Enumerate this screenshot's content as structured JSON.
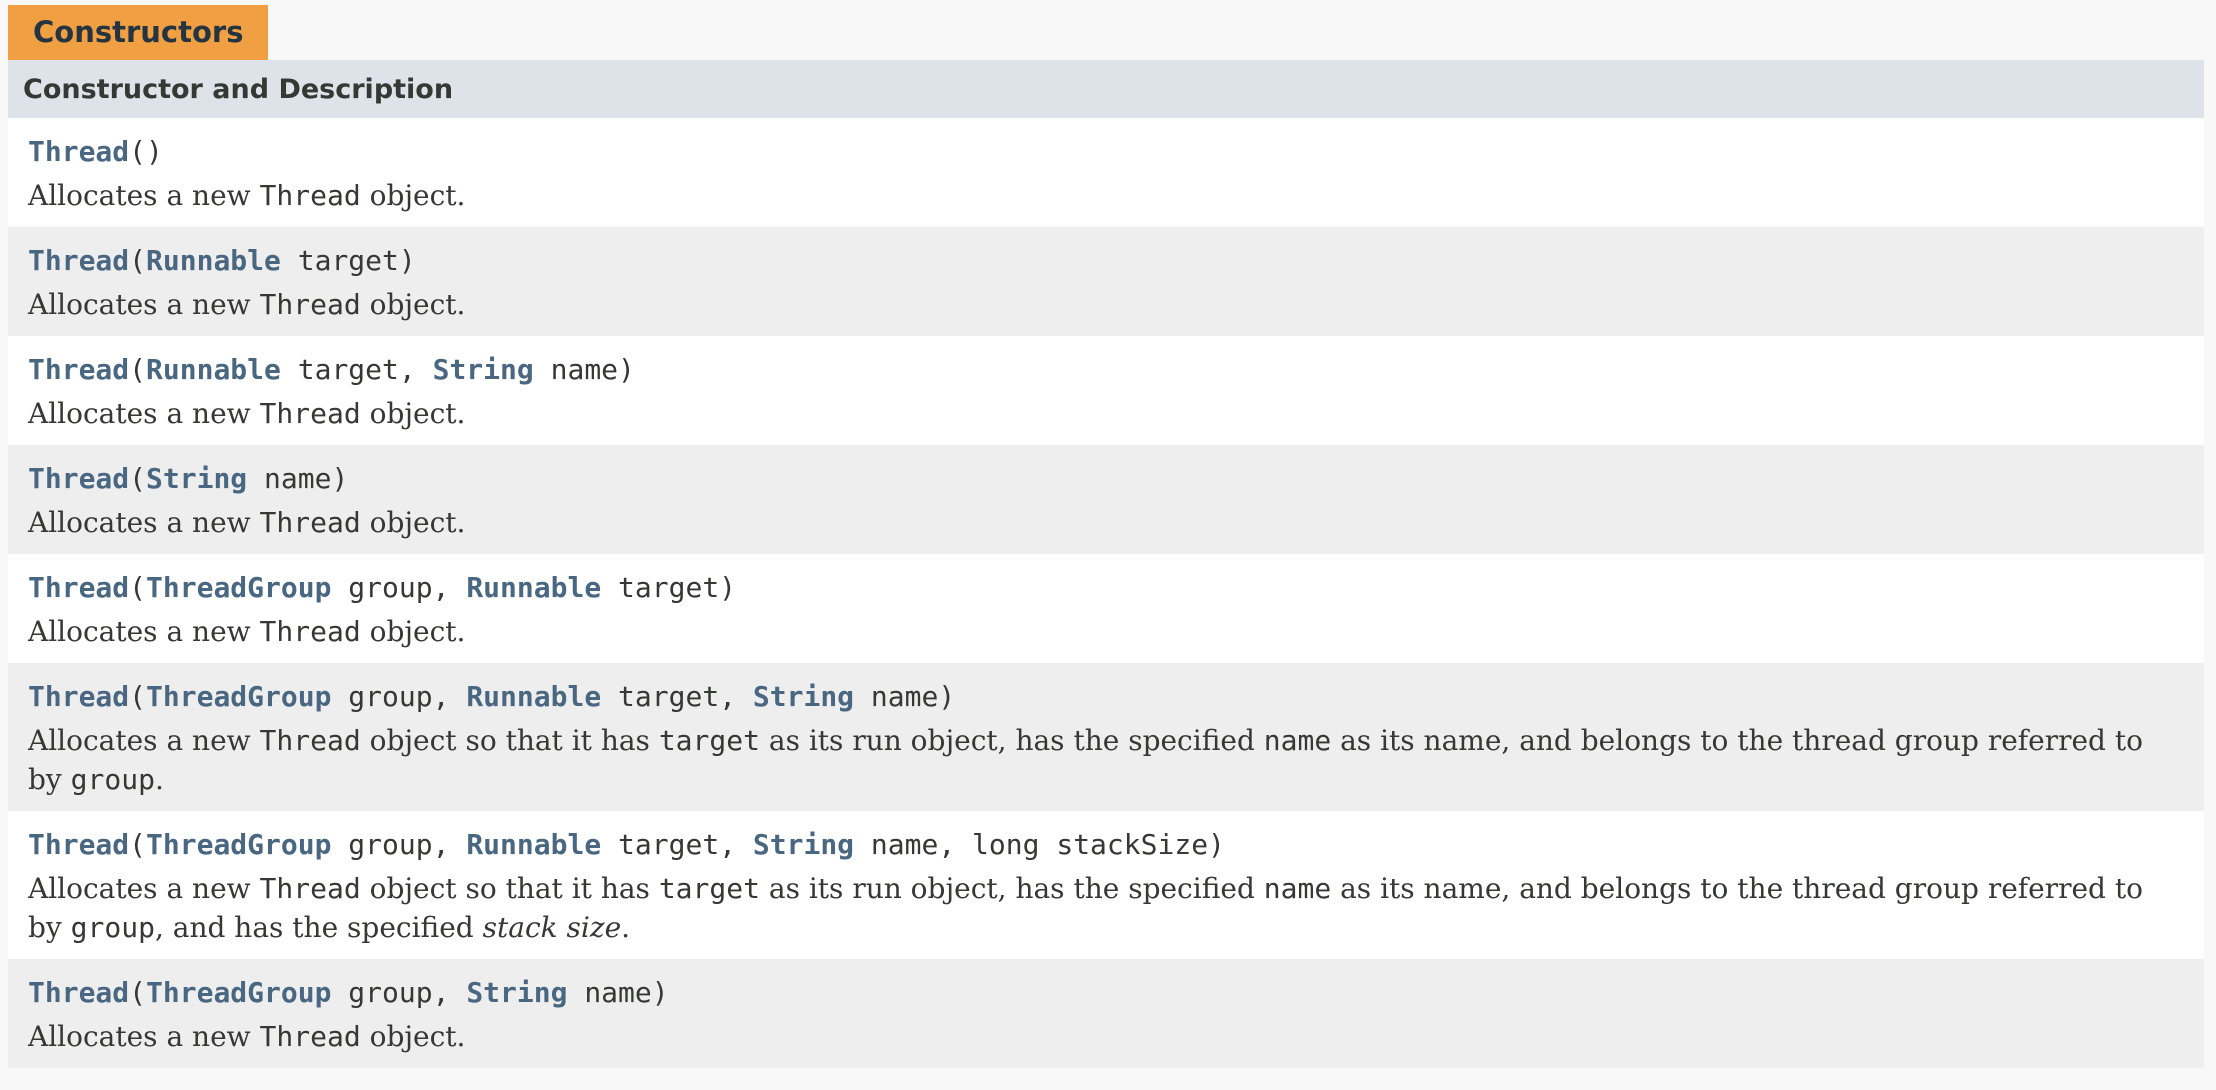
{
  "caption": "Constructors",
  "table_header": "Constructor and Description",
  "constructors": [
    {
      "sig": [
        {
          "t": "Thread",
          "link": true
        },
        {
          "t": "()"
        }
      ],
      "desc": [
        {
          "t": "Allocates a new "
        },
        {
          "t": "Thread",
          "code": true
        },
        {
          "t": " object."
        }
      ]
    },
    {
      "sig": [
        {
          "t": "Thread",
          "link": true
        },
        {
          "t": "("
        },
        {
          "t": "Runnable",
          "link": true
        },
        {
          "t": " target)"
        }
      ],
      "desc": [
        {
          "t": "Allocates a new "
        },
        {
          "t": "Thread",
          "code": true
        },
        {
          "t": " object."
        }
      ]
    },
    {
      "sig": [
        {
          "t": "Thread",
          "link": true
        },
        {
          "t": "("
        },
        {
          "t": "Runnable",
          "link": true
        },
        {
          "t": " target, "
        },
        {
          "t": "String",
          "link": true
        },
        {
          "t": " name)"
        }
      ],
      "desc": [
        {
          "t": "Allocates a new "
        },
        {
          "t": "Thread",
          "code": true
        },
        {
          "t": " object."
        }
      ]
    },
    {
      "sig": [
        {
          "t": "Thread",
          "link": true
        },
        {
          "t": "("
        },
        {
          "t": "String",
          "link": true
        },
        {
          "t": " name)"
        }
      ],
      "desc": [
        {
          "t": "Allocates a new "
        },
        {
          "t": "Thread",
          "code": true
        },
        {
          "t": " object."
        }
      ]
    },
    {
      "sig": [
        {
          "t": "Thread",
          "link": true
        },
        {
          "t": "("
        },
        {
          "t": "ThreadGroup",
          "link": true
        },
        {
          "t": " group, "
        },
        {
          "t": "Runnable",
          "link": true
        },
        {
          "t": " target)"
        }
      ],
      "desc": [
        {
          "t": "Allocates a new "
        },
        {
          "t": "Thread",
          "code": true
        },
        {
          "t": " object."
        }
      ]
    },
    {
      "sig": [
        {
          "t": "Thread",
          "link": true
        },
        {
          "t": "("
        },
        {
          "t": "ThreadGroup",
          "link": true
        },
        {
          "t": " group, "
        },
        {
          "t": "Runnable",
          "link": true
        },
        {
          "t": " target, "
        },
        {
          "t": "String",
          "link": true
        },
        {
          "t": " name)"
        }
      ],
      "desc": [
        {
          "t": "Allocates a new "
        },
        {
          "t": "Thread",
          "code": true
        },
        {
          "t": " object so that it has "
        },
        {
          "t": "target",
          "code": true
        },
        {
          "t": " as its run object, has the specified "
        },
        {
          "t": "name",
          "code": true
        },
        {
          "t": " as its name, and belongs to the thread group referred to by "
        },
        {
          "t": "group",
          "code": true
        },
        {
          "t": "."
        }
      ]
    },
    {
      "sig": [
        {
          "t": "Thread",
          "link": true
        },
        {
          "t": "("
        },
        {
          "t": "ThreadGroup",
          "link": true
        },
        {
          "t": " group, "
        },
        {
          "t": "Runnable",
          "link": true
        },
        {
          "t": " target, "
        },
        {
          "t": "String",
          "link": true
        },
        {
          "t": " name, long stackSize)"
        }
      ],
      "desc": [
        {
          "t": "Allocates a new "
        },
        {
          "t": "Thread",
          "code": true
        },
        {
          "t": " object so that it has "
        },
        {
          "t": "target",
          "code": true
        },
        {
          "t": " as its run object, has the specified "
        },
        {
          "t": "name",
          "code": true
        },
        {
          "t": " as its name, and belongs to the thread group referred to by "
        },
        {
          "t": "group",
          "code": true
        },
        {
          "t": ", and has the specified "
        },
        {
          "t": "stack size",
          "em": true
        },
        {
          "t": "."
        }
      ]
    },
    {
      "sig": [
        {
          "t": "Thread",
          "link": true
        },
        {
          "t": "("
        },
        {
          "t": "ThreadGroup",
          "link": true
        },
        {
          "t": " group, "
        },
        {
          "t": "String",
          "link": true
        },
        {
          "t": " name)"
        }
      ],
      "desc": [
        {
          "t": "Allocates a new "
        },
        {
          "t": "Thread",
          "code": true
        },
        {
          "t": " object."
        }
      ]
    }
  ]
}
